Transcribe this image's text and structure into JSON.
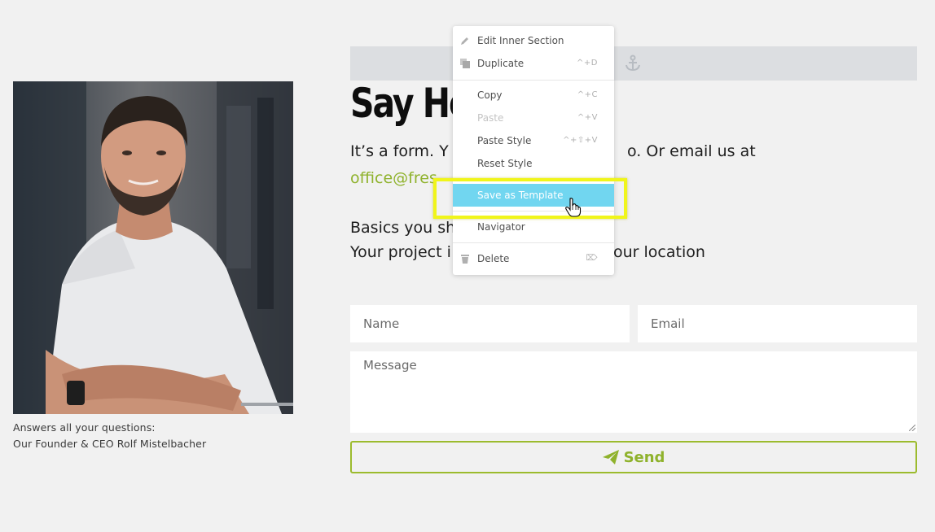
{
  "profile": {
    "caption_line1": "Answers all your questions:",
    "caption_line2": "Our Founder & CEO Rolf Mistelbacher"
  },
  "contact": {
    "heading": "Say He",
    "para1_start": "It’s a form. Y",
    "para1_end": "o. Or email us at",
    "email": "office@fres",
    "para3": "Basics you sh",
    "para4_start": "Your project i",
    "para4_end": "our location"
  },
  "form": {
    "name_placeholder": "Name",
    "email_placeholder": "Email",
    "message_placeholder": "Message",
    "send_label": "Send"
  },
  "context_menu": {
    "items": [
      {
        "label": "Edit Inner Section",
        "shortcut": "",
        "icon": "pencil-icon"
      },
      {
        "label": "Duplicate",
        "shortcut": "^+D",
        "icon": "duplicate-icon"
      },
      {
        "label": "Copy",
        "shortcut": "^+C",
        "icon": ""
      },
      {
        "label": "Paste",
        "shortcut": "^+V",
        "icon": "",
        "disabled": true
      },
      {
        "label": "Paste Style",
        "shortcut": "^+⇧+V",
        "icon": ""
      },
      {
        "label": "Reset Style",
        "shortcut": "",
        "icon": ""
      },
      {
        "label": "Save as Template",
        "shortcut": "",
        "icon": "",
        "active": true
      },
      {
        "label": "Navigator",
        "shortcut": "",
        "icon": ""
      },
      {
        "label": "Delete",
        "shortcut": "⌦",
        "icon": "trash-icon"
      }
    ]
  },
  "colors": {
    "accent_green": "#8fb22c",
    "menu_active": "#71d6f0",
    "highlight_yellow": "#f0f51a",
    "page_bg": "#f1f1f1"
  }
}
